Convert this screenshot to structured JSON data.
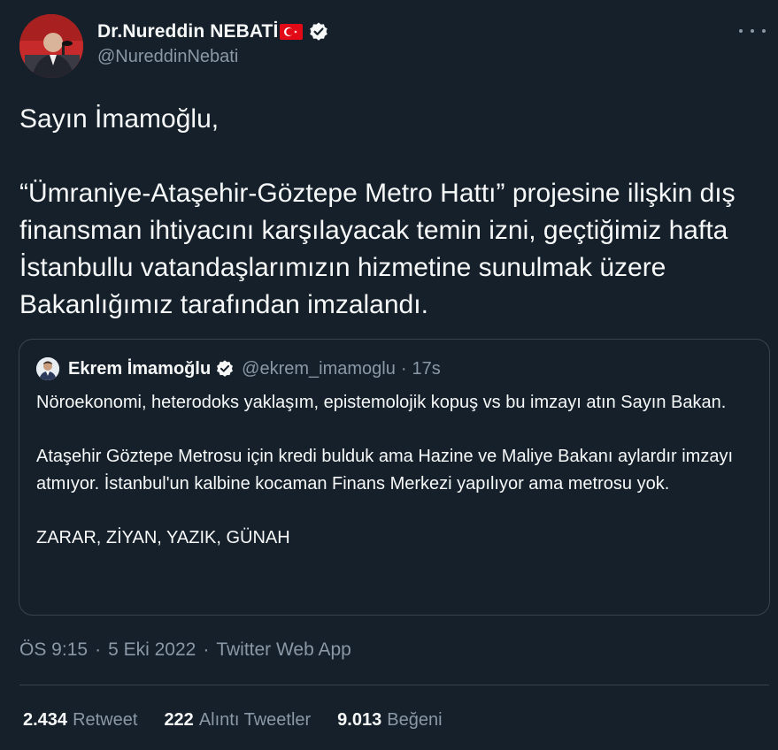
{
  "author": {
    "display_name": "Dr.Nureddin NEBATİ",
    "handle": "@NureddinNebati",
    "flag_icon": "turkey-flag-icon",
    "verified_icon": "verified-badge-icon"
  },
  "more_icon": "more-horizontal-icon",
  "tweet": {
    "lines": [
      "Sayın İmamoğlu,",
      "",
      "“Ümraniye-Ataşehir-Göztepe Metro Hattı” projesine ilişkin dış finansman ihtiyacını karşılayacak temin izni, geçtiğimiz hafta İstanbullu vatandaşlarımızın hizmetine sunulmak üzere Bakanlığımız tarafından imzalandı."
    ]
  },
  "quote": {
    "display_name": "Ekrem İmamoğlu",
    "handle": "@ekrem_imamoglu",
    "dot": "·",
    "time": "17s",
    "paragraphs": [
      "Nöroekonomi, heterodoks yaklaşım, epistemolojik kopuş vs bu imzayı atın Sayın Bakan.",
      "Ataşehir Göztepe Metrosu için kredi bulduk ama Hazine ve Maliye Bakanı aylardır imzayı atmıyor. İstanbul'un kalbine kocaman Finans Merkezi yapılıyor ama metrosu yok.",
      "ZARAR, ZİYAN, YAZIK, GÜNAH"
    ]
  },
  "meta": {
    "time": "ÖS 9:15",
    "sep1": "·",
    "date": "5 Eki 2022",
    "sep2": "·",
    "source": "Twitter Web App"
  },
  "stats": {
    "retweets": {
      "count": "2.434",
      "label": "Retweet"
    },
    "quotes": {
      "count": "222",
      "label": "Alıntı Tweetler"
    },
    "likes": {
      "count": "9.013",
      "label": "Beğeni"
    }
  },
  "colors": {
    "background": "#15202b",
    "text": "#f7f9f9",
    "secondary": "#8b98a5",
    "border": "#38444d",
    "verified": "#1d9bf0"
  }
}
